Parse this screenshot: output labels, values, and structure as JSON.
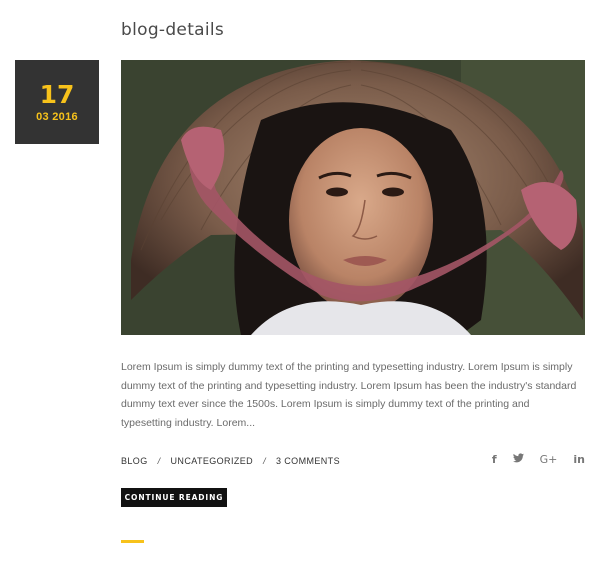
{
  "post": {
    "title": "blog-details",
    "date": {
      "day": "17",
      "month_year": "03 2016"
    },
    "excerpt": "Lorem Ipsum is simply dummy text of the printing and typesetting industry. Lorem Ipsum is simply dummy text of the printing and typesetting industry. Lorem Ipsum has been the industry's standard dummy text ever since the 1500s. Lorem Ipsum is simply dummy text of the printing and typesetting industry. Lorem...",
    "meta": {
      "category1": "BLOG",
      "separator": "/",
      "category2": "UNCATEGORIZED",
      "comments": "3 COMMENTS"
    },
    "button_label": "CONTINUE READING"
  },
  "social": {
    "facebook": "f",
    "twitter": "❄",
    "googleplus": "G+",
    "linkedin": "in"
  },
  "colors": {
    "accent": "#f7c21b",
    "date_bg": "#333333",
    "button_bg": "#111111"
  }
}
